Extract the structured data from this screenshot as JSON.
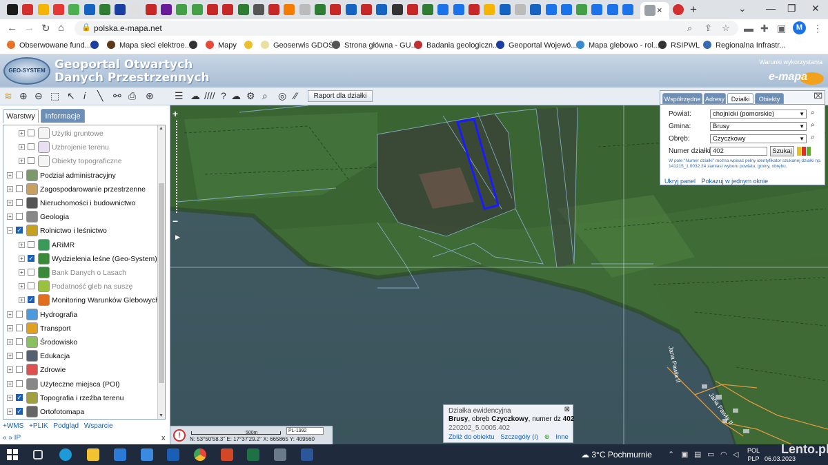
{
  "browser": {
    "url": "polska.e-mapa.net",
    "active_tab_close": "×",
    "new_tab": "+",
    "profile_initial": "M",
    "bookmarks": [
      {
        "label": "Obserwowane fund...",
        "color": "#e8712a"
      },
      {
        "label": "",
        "color": "#1a3fa0"
      },
      {
        "label": "Mapa sieci elektroe...",
        "color": "#5a3a1a"
      },
      {
        "label": "",
        "color": "#333333"
      },
      {
        "label": "Mapy",
        "color": "#e84a3a"
      },
      {
        "label": "",
        "color": "#e8c02a"
      },
      {
        "label": "Geoserwis GDOŚ",
        "color": "#e8e0a0"
      },
      {
        "label": "Strona główna - GU...",
        "color": "#555555"
      },
      {
        "label": "Badania geologiczn...",
        "color": "#c03030"
      },
      {
        "label": "Geoportal Wojewó...",
        "color": "#1a3fa0"
      },
      {
        "label": "Mapa glebowo - rol...",
        "color": "#3a8ad0"
      },
      {
        "label": "RSIPWL",
        "color": "#333333"
      },
      {
        "label": "Regionalna Infrastr...",
        "color": "#3a6ab0"
      }
    ]
  },
  "header": {
    "title_line1": "Geoportal Otwartych",
    "title_line2": "Danych Przestrzennych",
    "logo_text": "GEO-SYSTEM",
    "terms_link": "Warunki wykorzystania",
    "brand": "e-mapa"
  },
  "toolbar": {
    "report_button": "Raport dla działki"
  },
  "left_panel": {
    "tabs": {
      "layers": "Warstwy",
      "info": "Informacje"
    },
    "layers": [
      {
        "label": "Użytki gruntowe",
        "indent": 1,
        "checked": false,
        "dim": true,
        "color": "#f4f4f4"
      },
      {
        "label": "Uzbrojenie terenu",
        "indent": 1,
        "checked": false,
        "dim": true,
        "color": "#e8e0f0"
      },
      {
        "label": "Obiekty topograficzne",
        "indent": 1,
        "checked": false,
        "dim": true,
        "color": "#f4f4f4"
      },
      {
        "label": "Podział administracyjny",
        "indent": 0,
        "checked": false,
        "dim": false,
        "color": "#7a9a6a"
      },
      {
        "label": "Zagospodarowanie przestrzenne",
        "indent": 0,
        "checked": false,
        "dim": false,
        "color": "#c8a060"
      },
      {
        "label": "Nieruchomości i budownictwo",
        "indent": 0,
        "checked": false,
        "dim": false,
        "color": "#555555"
      },
      {
        "label": "Geologia",
        "indent": 0,
        "checked": false,
        "dim": false,
        "color": "#888888"
      },
      {
        "label": "Rolnictwo i leśnictwo",
        "indent": 0,
        "checked": true,
        "dim": false,
        "color": "#c8a020",
        "expanded": true
      },
      {
        "label": "ARiMR",
        "indent": 1,
        "checked": false,
        "dim": false,
        "color": "#3a9a5a"
      },
      {
        "label": "Wydzielenia leśne (Geo-System)",
        "indent": 1,
        "checked": true,
        "dim": false,
        "color": "#3a8a3a"
      },
      {
        "label": "Bank Danych o Lasach",
        "indent": 1,
        "checked": false,
        "dim": true,
        "color": "#3a8a3a"
      },
      {
        "label": "Podatność gleb na suszę",
        "indent": 1,
        "checked": false,
        "dim": true,
        "color": "#9ac040"
      },
      {
        "label": "Monitoring Warunków Glebowych",
        "indent": 1,
        "checked": true,
        "dim": false,
        "color": "#e07020"
      },
      {
        "label": "Hydrografia",
        "indent": 0,
        "checked": false,
        "dim": false,
        "color": "#4a9ae0"
      },
      {
        "label": "Transport",
        "indent": 0,
        "checked": false,
        "dim": false,
        "color": "#e0a020"
      },
      {
        "label": "Środowisko",
        "indent": 0,
        "checked": false,
        "dim": false,
        "color": "#8ac060"
      },
      {
        "label": "Edukacja",
        "indent": 0,
        "checked": false,
        "dim": false,
        "color": "#556070"
      },
      {
        "label": "Zdrowie",
        "indent": 0,
        "checked": false,
        "dim": false,
        "color": "#e05050"
      },
      {
        "label": "Użyteczne miejsca (POI)",
        "indent": 0,
        "checked": false,
        "dim": false,
        "color": "#888888"
      },
      {
        "label": "Topografia i rzeźba terenu",
        "indent": 0,
        "checked": true,
        "dim": false,
        "color": "#a0a040"
      },
      {
        "label": "Ortofotomapa",
        "indent": 0,
        "checked": true,
        "dim": false,
        "color": "#666666"
      }
    ],
    "footer_links": [
      "+WMS",
      "+PLIK",
      "Podgląd",
      "Wsparcie"
    ],
    "footer2": "« »  IP",
    "close": "x"
  },
  "search_panel": {
    "tabs": [
      "Współrzędne",
      "Adresy",
      "Działki",
      "Obiekty"
    ],
    "active_tab": "Działki",
    "powiat_label": "Powiat:",
    "powiat_value": "chojnicki (pomorskie)",
    "gmina_label": "Gmina:",
    "gmina_value": "Brusy",
    "obreb_label": "Obręb:",
    "obreb_value": "Czyczkowy",
    "parcel_label": "Numer działki:",
    "parcel_value": "402",
    "search_button": "Szukaj",
    "hint": "W pole \"Numer działki\" można wpisać pełny identyfikator szukanej działki np. 141215_1.0032.24 zamiast wyboru powiatu, gminy, obrębu.",
    "links": [
      "Ukryj panel",
      "Pokazuj w jednym oknie"
    ],
    "close": "⌧"
  },
  "info_popup": {
    "title": "Działka ewidencyjna",
    "municipality": "Brusy",
    "obreb_prefix": ", obręb ",
    "obreb": "Czyczkowy",
    "number_prefix": ", numer dz ",
    "number": "402",
    "parcel_id": "220202_5.0005.402",
    "links": [
      "Zbliż do obiektu",
      "Szczegóły (I)",
      "Inne"
    ],
    "close": "⊠"
  },
  "status": {
    "scale": "500m",
    "crs": "PL-1992",
    "coordinates": "N: 53°50'58.3\"  E: 17°37'29.2\"   X: 665865     Y: 409560",
    "info_icon": "!"
  },
  "map": {
    "street_label_1": "Jana Pawła II",
    "street_label_2": "Jana Pawła II",
    "zoom_in": "+",
    "zoom_out": "−"
  },
  "taskbar": {
    "weather": "3°C  Pochmurnie",
    "language": "POL\nPLP",
    "lang_top": "POL",
    "lang_bottom": "PLP",
    "date": "06.03.2023",
    "time": ""
  },
  "watermark": "Lento.pl"
}
